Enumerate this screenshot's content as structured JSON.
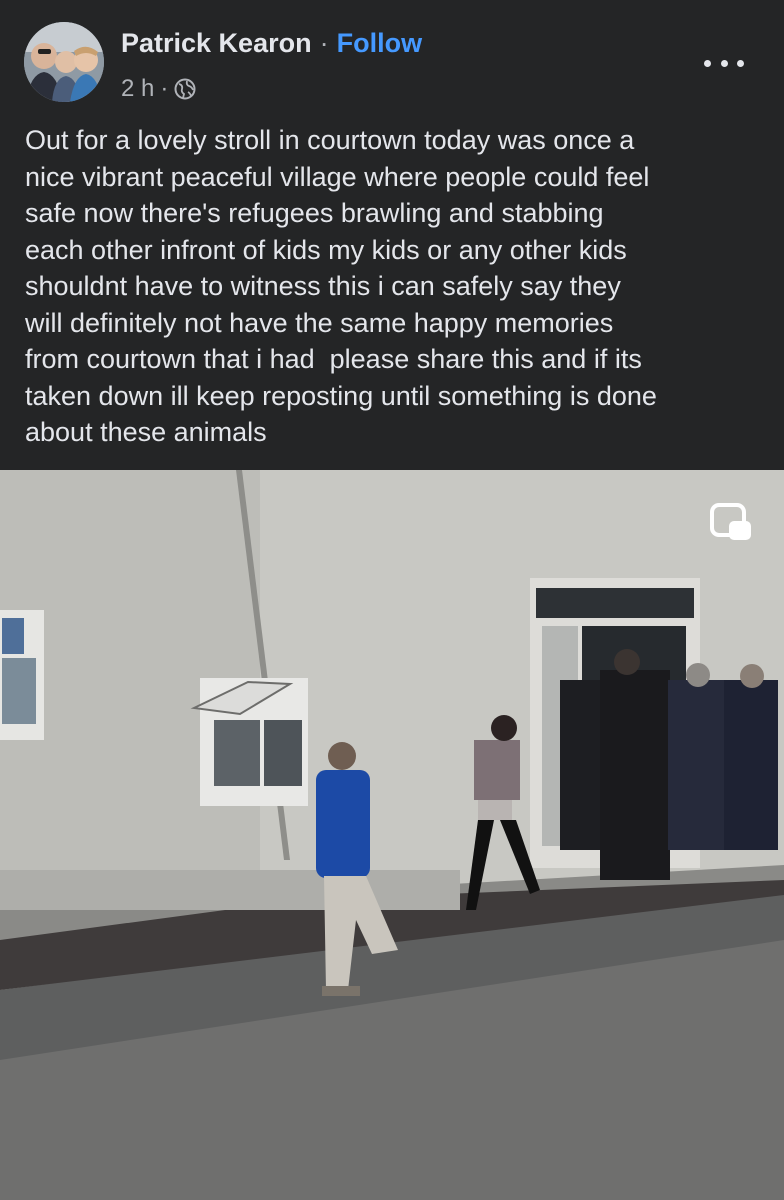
{
  "post": {
    "author": "Patrick Kearon",
    "separator": "·",
    "follow_label": "Follow",
    "timestamp": "2 h",
    "meta_separator": "·",
    "privacy_icon": "globe-icon",
    "more_icon": "more-options-icon",
    "body": "Out for a lovely stroll in courtown today was once a\nnice vibrant peaceful village where people could feel\nsafe now there's refugees brawling and stabbing\neach other infront of kids my kids or any other kids\nshouldnt have to witness this i can safely say they\nwill definitely not have the same happy memories\nfrom courtown that i had  please share this and if its\ntaken down ill keep reposting until something is done\nabout these animals"
  },
  "media": {
    "type": "video",
    "pip_icon": "picture-in-picture-icon"
  },
  "colors": {
    "background": "#242526",
    "text": "#e4e6eb",
    "secondary_text": "#b0b3b8",
    "link": "#4599ff"
  }
}
